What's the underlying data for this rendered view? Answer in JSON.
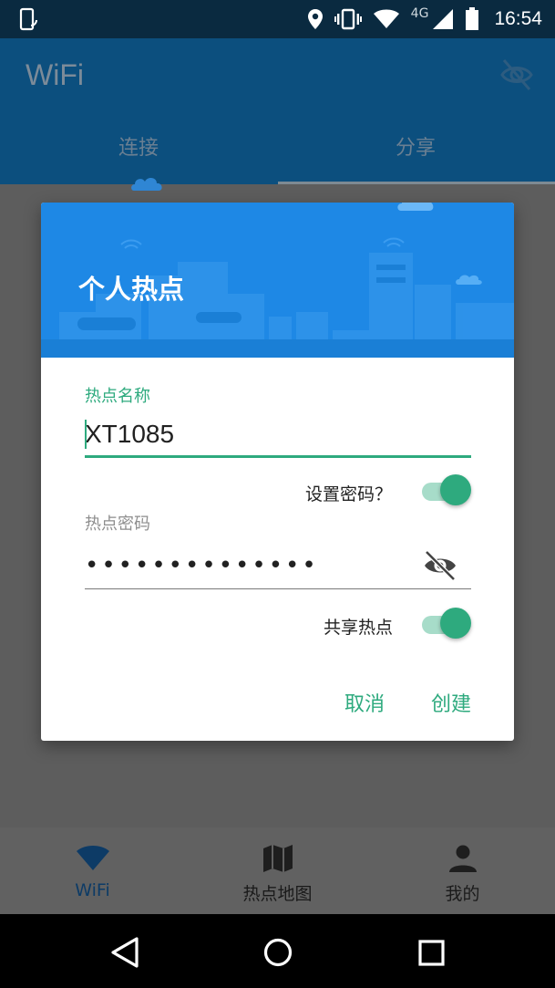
{
  "status_bar": {
    "network": "4G",
    "time": "16:54",
    "icons": [
      "phone-rotate-icon",
      "location-icon",
      "vibrate-icon",
      "wifi-icon",
      "signal-icon",
      "battery-icon"
    ]
  },
  "app_bar": {
    "title": "WiFi",
    "tabs": [
      {
        "label": "连接",
        "selected": false
      },
      {
        "label": "分享",
        "selected": true
      }
    ]
  },
  "dialog": {
    "title": "个人热点",
    "name_label": "热点名称",
    "name_value": "XT1085",
    "set_password_label": "设置密码？",
    "set_password_on": true,
    "password_label": "热点密码",
    "password_value": "••••••••••••••",
    "share_hotspot_label": "共享热点",
    "share_hotspot_on": true,
    "cancel_label": "取消",
    "create_label": "创建"
  },
  "bottom_nav": {
    "items": [
      {
        "label": "WiFi",
        "icon": "wifi-icon",
        "active": true
      },
      {
        "label": "热点地图",
        "icon": "map-icon",
        "active": false
      },
      {
        "label": "我的",
        "icon": "person-icon",
        "active": false
      }
    ]
  },
  "colors": {
    "accent": "#2eaa7e",
    "dialog_header": "#1e88e5",
    "app_bar": "#0c4f7e"
  }
}
